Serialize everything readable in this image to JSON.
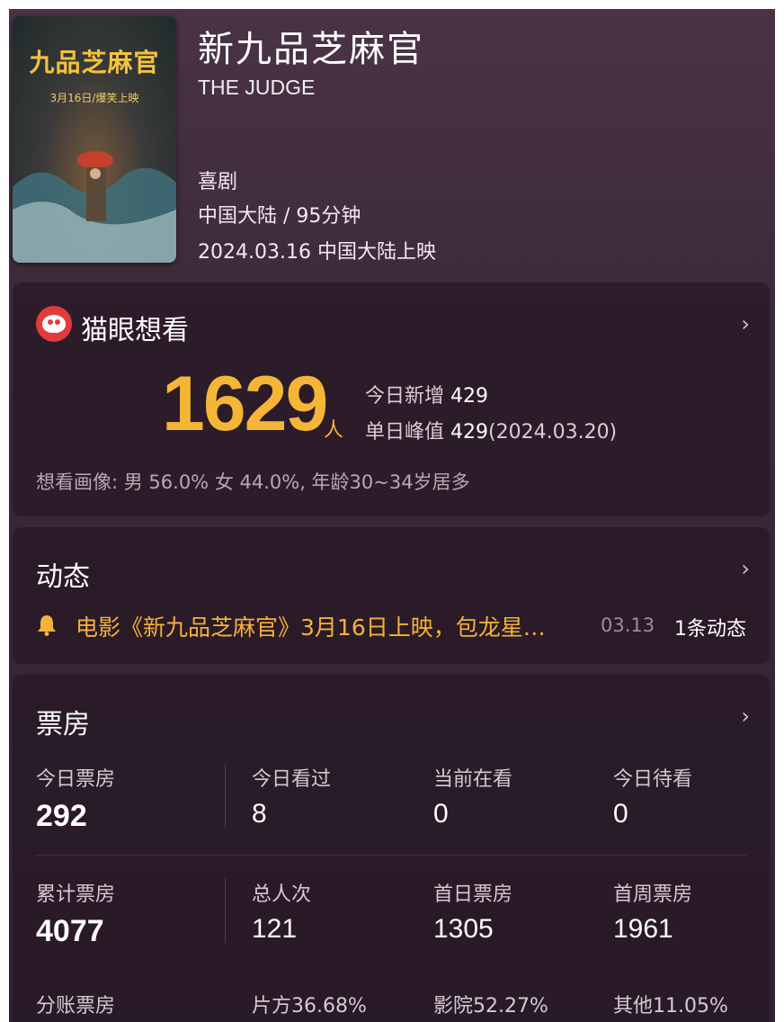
{
  "movie": {
    "title": "新九品芝麻官",
    "english_title": "THE JUDGE",
    "genre": "喜剧",
    "region_duration": "中国大陆 / 95分钟",
    "release": "2024.03.16 中国大陆上映",
    "poster": {
      "title": "九品芝麻官",
      "date_text": "3月16日/爆笑上映"
    }
  },
  "want": {
    "title": "猫眼想看",
    "count": "1629",
    "unit": "人",
    "today_label": "今日新增",
    "today_value": "429",
    "peak_label": "单日峰值",
    "peak_value": "429",
    "peak_date": "(2024.03.20)",
    "portrait": "想看画像: 男 56.0%  女 44.0%, 年龄30~34岁居多"
  },
  "news": {
    "title": "动态",
    "text": "电影《新九品芝麻官》3月16日上映，包龙星…",
    "date": "03.13",
    "count": "1条动态"
  },
  "boxoffice": {
    "title": "票房",
    "row1": [
      {
        "label": "今日票房",
        "value": "292"
      },
      {
        "label": "今日看过",
        "value": "8"
      },
      {
        "label": "当前在看",
        "value": "0"
      },
      {
        "label": "今日待看",
        "value": "0"
      }
    ],
    "row2": [
      {
        "label": "累计票房",
        "value": "4077"
      },
      {
        "label": "总人次",
        "value": "121"
      },
      {
        "label": "首日票房",
        "value": "1305"
      },
      {
        "label": "首周票房",
        "value": "1961"
      }
    ],
    "row3": [
      {
        "label": "分账票房"
      },
      {
        "label": "片方36.68%"
      },
      {
        "label": "影院52.27%"
      },
      {
        "label": "其他11.05%"
      }
    ]
  },
  "icons": {
    "chevron": "›",
    "bell": "🔔"
  },
  "colors": {
    "accent": "#f5b536",
    "brand_red": "#e23b3b"
  }
}
